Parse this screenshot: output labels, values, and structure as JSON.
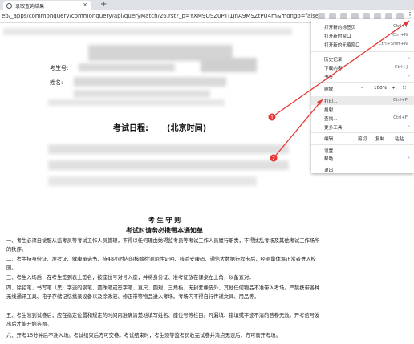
{
  "tab": {
    "title": "录取查询结果",
    "close": "×",
    "new_tab": "+"
  },
  "address": {
    "url": "eb/_apps/commonquery/commonquery/api/queryMatch/26.rst?_p=YXM9OSZ0PTI1JnA9MSZtPU4m&mongo=false"
  },
  "doc": {
    "exam_no_label": "考生号:",
    "name_label": "姓名:",
    "schedule_title": "考试日程:",
    "schedule_tz": "(北京时间)",
    "rules_title": "考 生 守 则",
    "notice_title": "考试时请务必携带本通知单",
    "paragraphs": [
      "一、考生必须自觉服从监考员等考试工作人员管理，不得以任何理由妨碍监考员等考试工作人员履行职责，不得扰乱考场及其他考试工作场所的秩序。",
      "二、考生持身份证、准考证、健康承诺书、持48小时内的核酸检测阴性证明、核验安康码、通信大数据行程卡后，经测量体温正常者进入校园。",
      "三、考生入场后，在考生签到表上签名，按座位号对号入座，并将身份证、准考证放在课桌左上角，以备查对。",
      "四、除铅笔、书写笔（黑）字迹的钢笔、圆珠笔或签字笔、直尺、圆规、三角板、无封套橡皮外，其他任何物品不准带入考场。严禁携带各种无线通讯工具、电子存储记忆播录设备以及涂改液、修正带等物品进入考场。考场内不得自行传递文具、用品等。",
      "五、考生领到试卷后，应在指定位置和规定的时间内准确清楚地填写姓名、座位号等栏目。凡漏填、错填或字迹不清的答卷无效。开考信号发出后才能开始答题。",
      "六、开考15分钟后不准入场。考试结束后方可交卷。考试结束时，考生须等监考员收完试卷并清点无误后，方可离开考场。"
    ]
  },
  "menu": {
    "items": [
      {
        "label": "打开新的标签页",
        "shortcut": "Ctrl+T"
      },
      {
        "label": "打开新的窗口",
        "shortcut": "Ctrl+N"
      },
      {
        "label": "打开新的无痕窗口",
        "shortcut": "Ctrl+Shift+N"
      },
      {
        "label": "历史记录",
        "arrow": "›"
      },
      {
        "label": "下载内容",
        "shortcut": "Ctrl+J"
      },
      {
        "label": "书签",
        "arrow": "›"
      },
      {
        "label": "缩放",
        "minus": "–",
        "value": "100%",
        "plus": "+",
        "fullscreen": "⛶"
      },
      {
        "label": "打印...",
        "shortcut": "Ctrl+P"
      },
      {
        "label": "投射..."
      },
      {
        "label": "查找...",
        "shortcut": "Ctrl+F"
      },
      {
        "label": "更多工具",
        "arrow": "›"
      },
      {
        "label": "编辑",
        "cut": "剪切",
        "copy": "复制",
        "paste": "粘贴"
      },
      {
        "label": "设置"
      },
      {
        "label": "帮助",
        "arrow": "›"
      },
      {
        "label": "退出"
      }
    ]
  },
  "annotations": {
    "marker_1": "1",
    "marker_2": "2",
    "color": "#e53935"
  }
}
